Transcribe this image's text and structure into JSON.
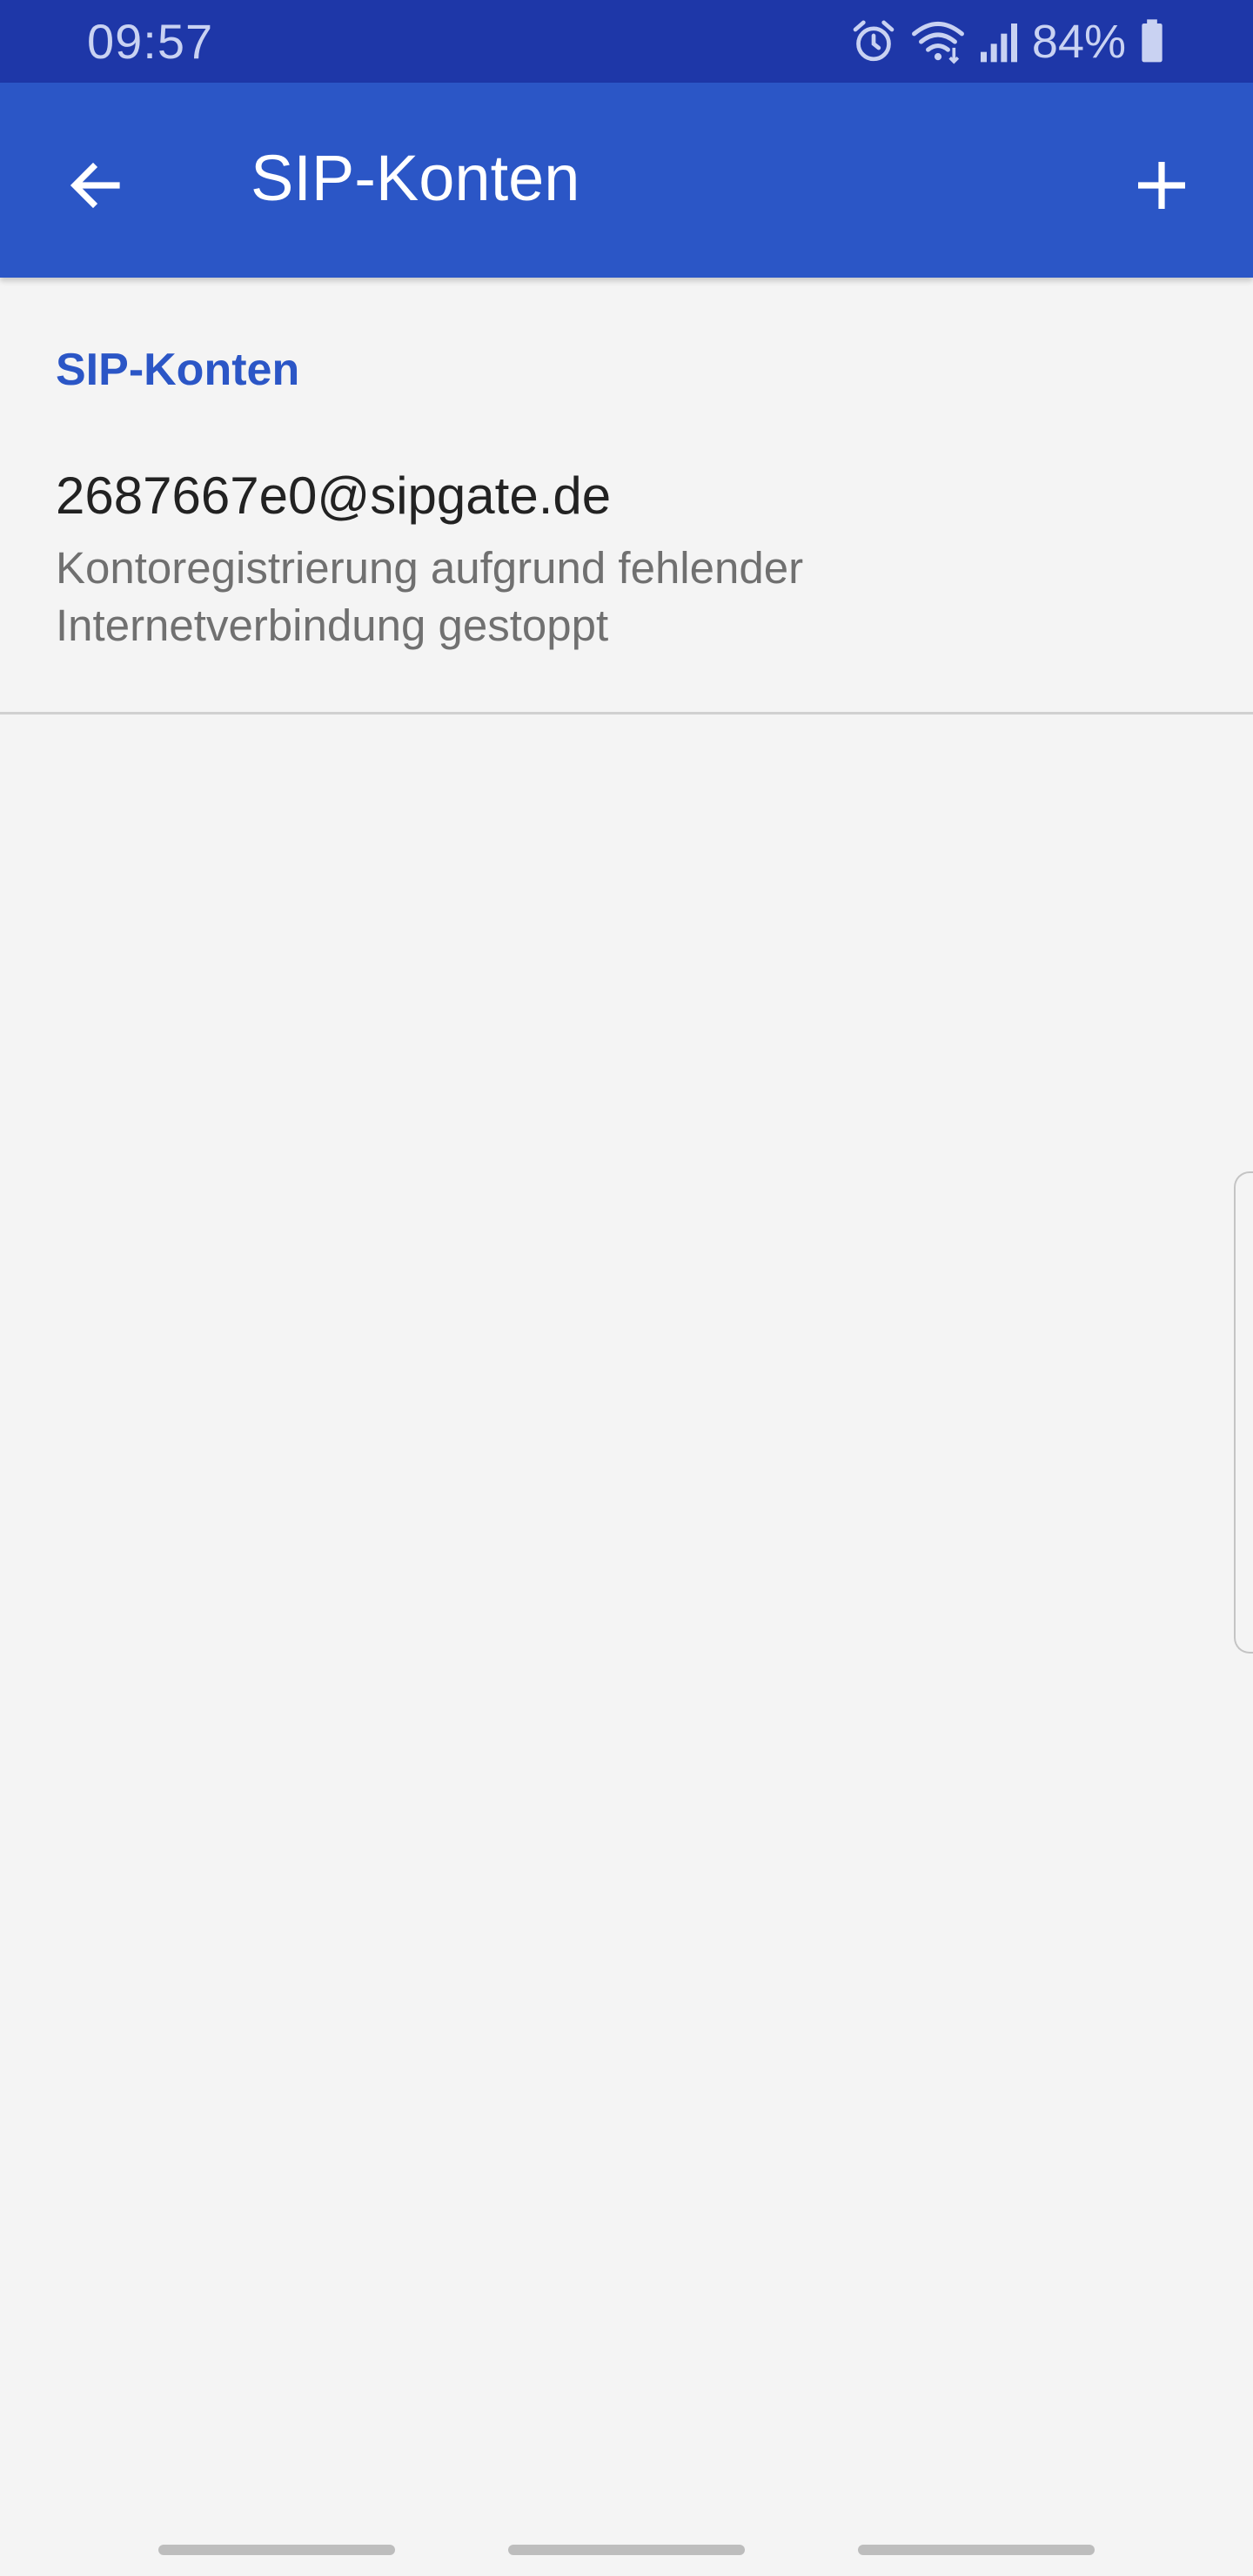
{
  "status_bar": {
    "time": "09:57",
    "battery_percent": "84%",
    "icons": [
      "alarm-icon",
      "wifi-icon",
      "signal-icon",
      "battery-icon"
    ]
  },
  "app_bar": {
    "title": "SIP-Konten",
    "back_icon": "arrow-back-icon",
    "add_icon": "plus-icon"
  },
  "section": {
    "header": "SIP-Konten",
    "accounts": [
      {
        "title": "2687667e0@sipgate.de",
        "summary": "Kontoregistrierung aufgrund fehlender Internetverbindung gestoppt"
      }
    ]
  },
  "colors": {
    "status_bar": "#1e37a8",
    "app_bar": "#2b56c6",
    "accent": "#2b56c6",
    "background": "#f4f4f4"
  }
}
